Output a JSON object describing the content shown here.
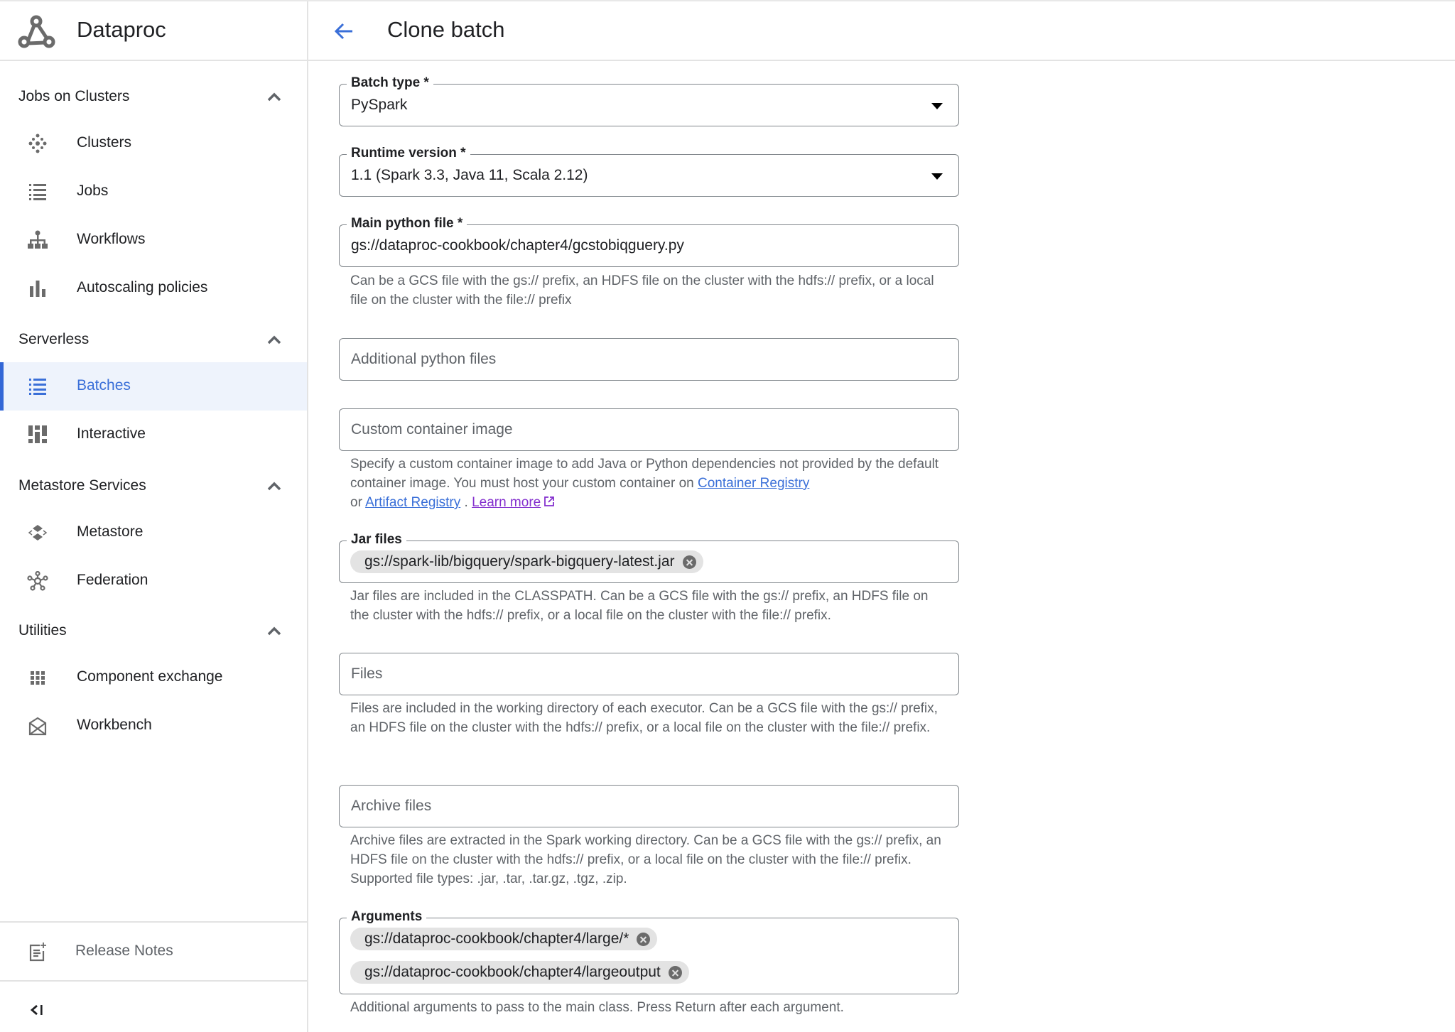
{
  "app": {
    "name": "Dataproc"
  },
  "header": {
    "title": "Clone batch"
  },
  "sidebar": {
    "sections": [
      {
        "label": "Jobs on Clusters",
        "items": [
          {
            "label": "Clusters",
            "icon": "clusters-icon"
          },
          {
            "label": "Jobs",
            "icon": "list-icon"
          },
          {
            "label": "Workflows",
            "icon": "workflow-icon"
          },
          {
            "label": "Autoscaling policies",
            "icon": "bar-chart-icon"
          }
        ]
      },
      {
        "label": "Serverless",
        "items": [
          {
            "label": "Batches",
            "icon": "list-icon",
            "active": true
          },
          {
            "label": "Interactive",
            "icon": "interactive-icon"
          }
        ]
      },
      {
        "label": "Metastore Services",
        "items": [
          {
            "label": "Metastore",
            "icon": "metastore-icon"
          },
          {
            "label": "Federation",
            "icon": "federation-icon"
          }
        ]
      },
      {
        "label": "Utilities",
        "items": [
          {
            "label": "Component exchange",
            "icon": "grid-icon"
          },
          {
            "label": "Workbench",
            "icon": "workbench-icon"
          }
        ]
      }
    ],
    "footer": {
      "release_notes": "Release Notes",
      "collapse_icon": "collapse-sidebar-icon"
    }
  },
  "form": {
    "batch_type": {
      "label": "Batch type *",
      "value": "PySpark"
    },
    "runtime_version": {
      "label": "Runtime version *",
      "value": "1.1 (Spark 3.3, Java 11, Scala 2.12)"
    },
    "main_python_file": {
      "label": "Main python file *",
      "value": "gs://dataproc-cookbook/chapter4/gcstobiqguery.py",
      "help": "Can be a GCS file with the gs:// prefix, an HDFS file on the cluster with the hdfs:// prefix, or a local file on the cluster with the file:// prefix"
    },
    "additional_python_files": {
      "placeholder": "Additional python files"
    },
    "custom_container_image": {
      "placeholder": "Custom container image",
      "help_before": "Specify a custom container image to add Java or Python dependencies not provided by the default container image. You must host your custom container on ",
      "link_container_registry": "Container Registry",
      "help_or": " or ",
      "link_artifact_registry": "Artifact Registry",
      "help_dot": " . ",
      "link_learn_more": "Learn more"
    },
    "jar_files": {
      "label": "Jar files",
      "chips": [
        "gs://spark-lib/bigquery/spark-bigquery-latest.jar"
      ],
      "help": "Jar files are included in the CLASSPATH. Can be a GCS file with the gs:// prefix, an HDFS file on the cluster with the hdfs:// prefix, or a local file on the cluster with the file:// prefix."
    },
    "files": {
      "placeholder": "Files",
      "help": "Files are included in the working directory of each executor. Can be a GCS file with the gs:// prefix, an HDFS file on the cluster with the hdfs:// prefix, or a local file on the cluster with the file:// prefix."
    },
    "archive_files": {
      "placeholder": "Archive files",
      "help": "Archive files are extracted in the Spark working directory. Can be a GCS file with the gs:// prefix, an HDFS file on the cluster with the hdfs:// prefix, or a local file on the cluster with the file:// prefix. Supported file types: .jar, .tar, .tar.gz, .tgz, .zip."
    },
    "arguments": {
      "label": "Arguments",
      "chips": [
        "gs://dataproc-cookbook/chapter4/large/*",
        "gs://dataproc-cookbook/chapter4/largeoutput"
      ],
      "help": "Additional arguments to pass to the main class. Press Return after each argument."
    }
  },
  "colors": {
    "accent": "#3a6fd8",
    "active_bg": "#eef3fc",
    "visited_link": "#8430ce",
    "icon_gray": "#6b6b6b"
  }
}
